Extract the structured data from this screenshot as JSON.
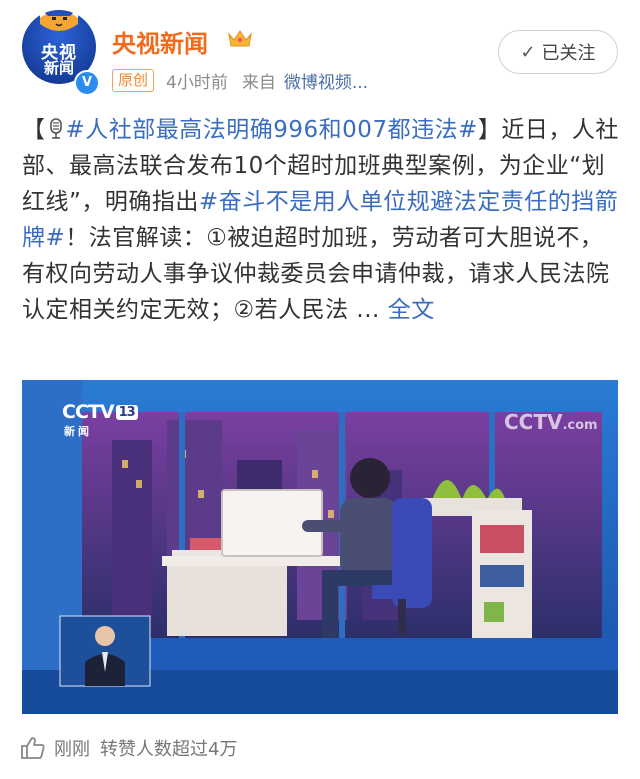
{
  "account": {
    "avatar_text_top": "央视",
    "avatar_text_bottom": "新闻",
    "verified_mark": "V",
    "name": "央视新闻",
    "crown_icon": "crown-icon",
    "tag": "原创",
    "time": "4小时前",
    "from_prefix": "来自",
    "source": "微博视频..."
  },
  "follow": {
    "check": "✓",
    "label": "已关注"
  },
  "post": {
    "bracket_open": "【",
    "hashtag1": "#人社部最高法明确996和007都违法#",
    "bracket_close": "】",
    "text1": "近日，人社部、最高法联合发布10个超时加班典型案例，为企业“划红线”，明确指出",
    "hashtag2": "#奋斗不是用人单位规避法定责任的挡箭牌#",
    "text2": "！法官解读：①被迫超时加班，劳动者可大胆说不，有权向劳动人事争议仲裁委员会申请仲裁，请求人民法院认定相关约定无效；②若人民法",
    "ellipsis": " ... ",
    "full_link": "全文"
  },
  "video": {
    "logo_left_main": "CCTV",
    "logo_left_num": "13",
    "logo_left_sub": "新闻",
    "logo_right_main": "CCTV",
    "logo_right_suffix": ".com"
  },
  "footer": {
    "like_icon": "thumbs-up-icon",
    "time": "刚刚",
    "reposts": "转赞人数超过4万"
  },
  "colors": {
    "brand_orange": "#f26b1d",
    "link_blue": "#3a6dc0",
    "tag_orange": "#f08a2c"
  }
}
